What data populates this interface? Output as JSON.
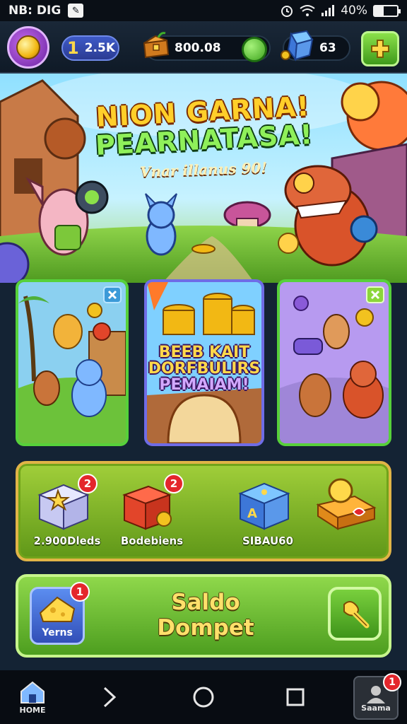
{
  "status_bar": {
    "left_text": "NB: DIG",
    "battery": "40%",
    "battery_level": 0.4
  },
  "resources": {
    "level": "1",
    "level_value": "2.5K",
    "chest_value": "800.08",
    "gem_value": "63"
  },
  "hero": {
    "title_line1": "NION GARNA!",
    "title_line2": "PEARNATASA!",
    "subtitle": "Vnar illanus 90!"
  },
  "cards": {
    "center_line1": "BEEB KAIT",
    "center_line2": "DORFBULIRS",
    "center_line3": "PEMAIAM!"
  },
  "items": [
    {
      "label": "2.900Dleds",
      "badge": "2"
    },
    {
      "label": "Bodebiens",
      "badge": "2"
    },
    {
      "label": "SIBAU60",
      "badge": ""
    },
    {
      "label": "",
      "badge": ""
    }
  ],
  "wallet": {
    "title": "Saldo Dompet",
    "left_label": "Yerns",
    "left_badge": "1"
  },
  "nav": {
    "home_label": "HOME",
    "profile_label": "Saama",
    "profile_badge": "1"
  },
  "colors": {
    "accent_green": "#57d13a",
    "accent_gold": "#ffcf2a",
    "badge_red": "#e4262c"
  },
  "icons": [
    "wifi-icon",
    "signal-icon",
    "battery-icon",
    "alarm-icon",
    "coin-icon",
    "chest-icon",
    "gem-icon",
    "dice-icon",
    "plus-icon",
    "star-box-icon",
    "gift-box-icon",
    "dice-cube-icon",
    "golden-key-icon",
    "home-icon",
    "back-icon",
    "circle-home-icon",
    "recent-apps-icon"
  ]
}
